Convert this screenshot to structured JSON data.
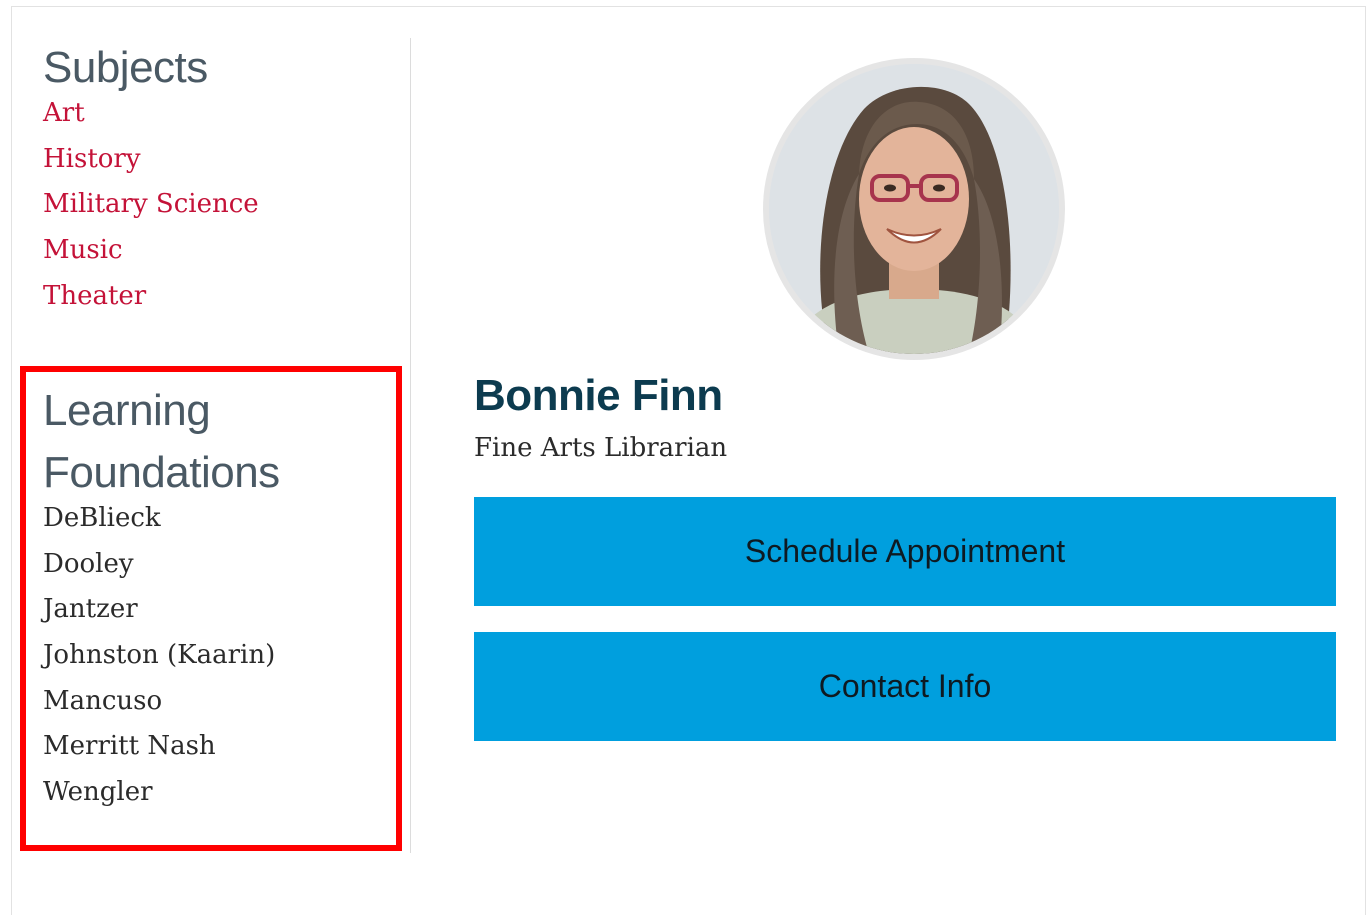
{
  "sidebar": {
    "subjects": {
      "heading": "Subjects",
      "items": [
        "Art",
        "History",
        "Military Science",
        "Music",
        "Theater"
      ]
    },
    "learning_foundations": {
      "heading_line1": "Learning",
      "heading_line2": "Foundations",
      "items": [
        "DeBlieck",
        "Dooley",
        "Jantzer",
        "Johnston (Kaarin)",
        "Mancuso",
        "Merritt Nash",
        "Wengler"
      ]
    }
  },
  "profile": {
    "name": "Bonnie Finn",
    "title": "Fine Arts Librarian",
    "schedule_label": "Schedule Appointment",
    "contact_label": "Contact Info"
  },
  "colors": {
    "link": "#c41238",
    "heading": "#4a5964",
    "name": "#0c3b4f",
    "button": "#009fde",
    "highlight": "#ff0000"
  }
}
